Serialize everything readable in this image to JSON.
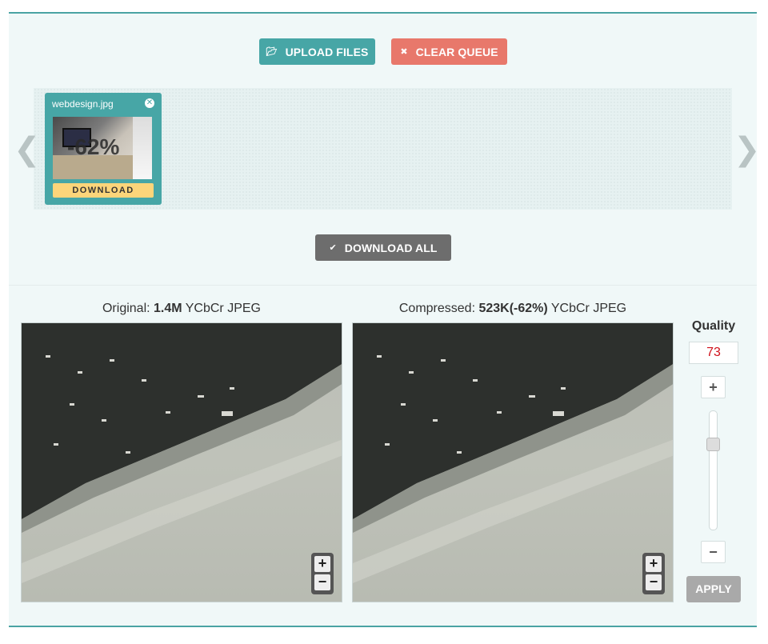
{
  "toolbar": {
    "upload_label": "UPLOAD FILES",
    "clear_label": "CLEAR QUEUE",
    "download_all_label": "DOWNLOAD ALL"
  },
  "queue": {
    "items": [
      {
        "filename": "webdesign.jpg",
        "savings": "-62%",
        "download_label": "DOWNLOAD"
      }
    ]
  },
  "compare": {
    "original": {
      "prefix": "Original: ",
      "size": "1.4M",
      "suffix": " YCbCr JPEG"
    },
    "compressed": {
      "prefix": "Compressed: ",
      "size": "523K(-62%)",
      "suffix": " YCbCr JPEG"
    }
  },
  "quality": {
    "label": "Quality",
    "value": "73",
    "apply_label": "APPLY",
    "slider_fraction": 0.73
  },
  "icons": {
    "upload": "folder-open-icon",
    "clear": "close-icon",
    "download_all": "check-icon",
    "prev": "chevron-left-icon",
    "next": "chevron-right-icon"
  },
  "colors": {
    "teal": "#47a6a6",
    "coral": "#e8786b",
    "gray_button": "#6d6d6d",
    "download_yellow": "#fcd57a",
    "quality_red": "#d0101a"
  }
}
